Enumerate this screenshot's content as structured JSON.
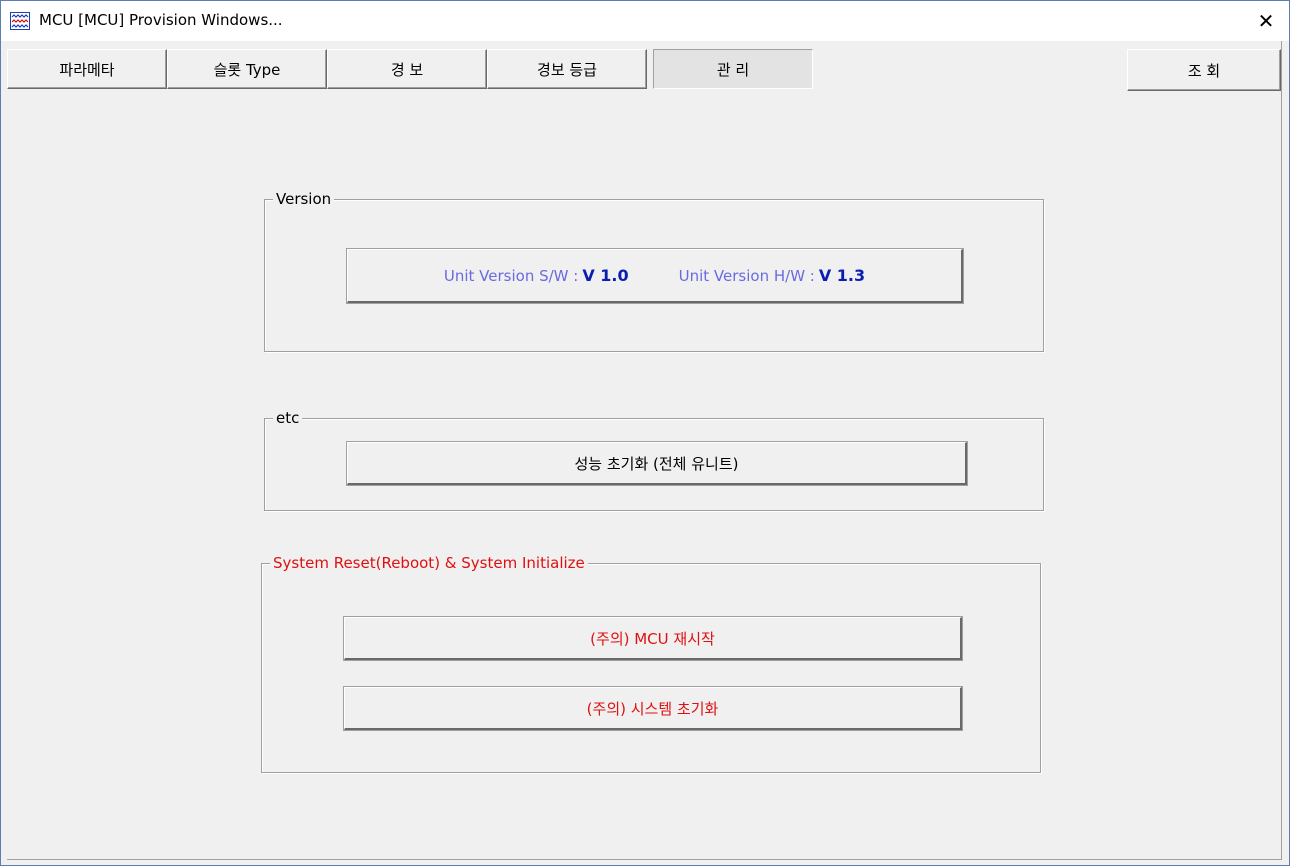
{
  "window": {
    "title": "MCU [MCU] Provision Windows...",
    "close_glyph": "✕",
    "icon": "app-waveform-icon"
  },
  "tabs": [
    {
      "label": "파라메타",
      "active": false
    },
    {
      "label": "슬롯 Type",
      "active": false
    },
    {
      "label": "경 보",
      "active": false
    },
    {
      "label": "경보 등급",
      "active": false
    },
    {
      "label": "관 리",
      "active": true
    }
  ],
  "query_button": {
    "label": "조 회"
  },
  "version_group": {
    "legend": "Version",
    "sw_label": "Unit Version S/W : ",
    "sw_value": "V 1.0",
    "hw_label": "Unit Version H/W : ",
    "hw_value": "V 1.3"
  },
  "etc_group": {
    "legend": "etc",
    "init_button": "성능 초기화 (전체 유니트)"
  },
  "system_group": {
    "legend": "System Reset(Reboot) & System Initialize",
    "reboot_button": "(주의) MCU 재시작",
    "init_button": "(주의) 시스템 초기화"
  },
  "colors": {
    "warning_red": "#e01010",
    "version_label": "#6a6ae0",
    "version_value": "#0a1fb0",
    "face": "#f0f0f0"
  }
}
